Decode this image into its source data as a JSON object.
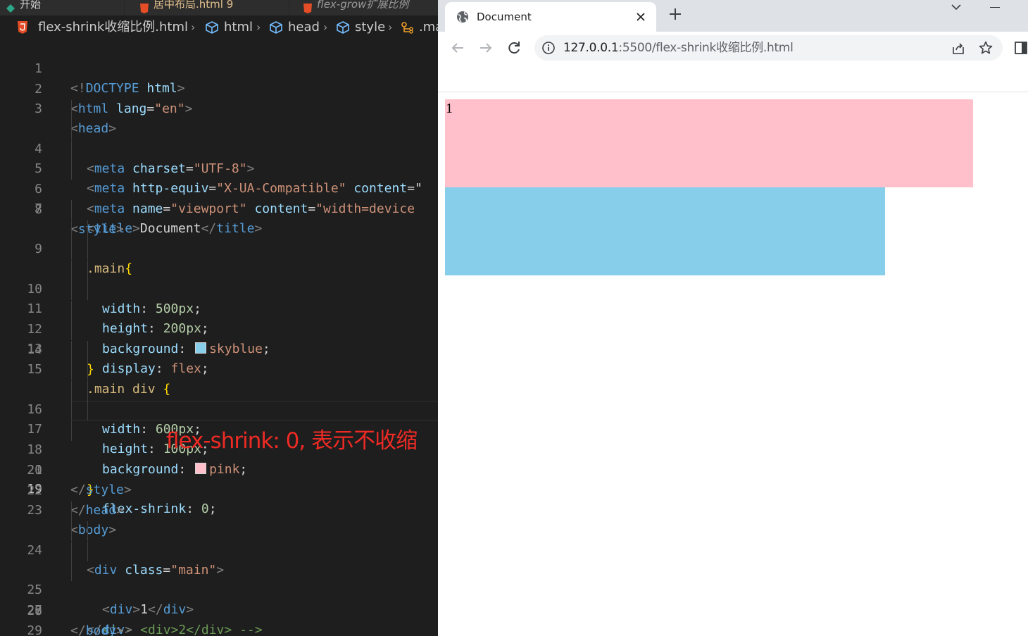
{
  "editor": {
    "tabs": [
      {
        "label": "开始"
      },
      {
        "label": "居中布局.html 9"
      },
      {
        "label": "flex-grow扩展比例"
      }
    ],
    "breadcrumb": {
      "file": "flex-shrink收缩比例.html",
      "items": [
        "html",
        "head",
        "style",
        ".ma"
      ]
    },
    "line_numbers": [
      "1",
      "2",
      "3",
      "4",
      "5",
      "6",
      "7",
      "8",
      "9",
      "10",
      "11",
      "12",
      "13",
      "14",
      "15",
      "16",
      "17",
      "18",
      "19",
      "20",
      "21",
      "22",
      "23",
      "24",
      "25",
      "26",
      "27",
      "28",
      "29"
    ],
    "active_line": "19",
    "code": {
      "l1": {
        "a": "<!",
        "b": "DOCTYPE",
        "c": " html",
        "d": ">"
      },
      "l2": {
        "a": "<",
        "b": "html",
        "c": " lang",
        "d": "=",
        "e": "\"en\"",
        "f": ">"
      },
      "l3": {
        "a": "<",
        "b": "head",
        "c": ">"
      },
      "l4": {
        "a": "<",
        "b": "meta",
        "c": " charset",
        "d": "=",
        "e": "\"UTF-8\"",
        "f": ">"
      },
      "l5": {
        "a": "<",
        "b": "meta",
        "c": " http-equiv",
        "d": "=",
        "e": "\"X-UA-Compatible\"",
        "f": " content",
        "g": "=\""
      },
      "l6": {
        "a": "<",
        "b": "meta",
        "c": " name",
        "d": "=",
        "e": "\"viewport\"",
        "f": " content",
        "g": "=",
        "h": "\"width=device"
      },
      "l7": {
        "a": "<",
        "b": "title",
        "c": ">",
        "d": "Document",
        "e": "</",
        "f": "title",
        "g": ">"
      },
      "l8": {
        "a": "<",
        "b": "style",
        "c": ">"
      },
      "l9": {
        "a": ".main",
        "b": "{"
      },
      "l10": {
        "a": "width",
        "b": ": ",
        "c": "500px",
        "d": ";"
      },
      "l11": {
        "a": "height",
        "b": ": ",
        "c": "200px",
        "d": ";"
      },
      "l12": {
        "a": "background",
        "b": ": ",
        "c": "skyblue",
        "d": ";"
      },
      "l13": {
        "a": "display",
        "b": ": ",
        "c": "flex",
        "d": ";"
      },
      "l14": {
        "a": "}"
      },
      "l15": {
        "a": ".main div",
        "b": " {"
      },
      "l16": {
        "a": "width",
        "b": ": ",
        "c": "600px",
        "d": ";"
      },
      "l17": {
        "a": "height",
        "b": ": ",
        "c": "100px",
        "d": ";"
      },
      "l18": {
        "a": "background",
        "b": ": ",
        "c": "pink",
        "d": ";"
      },
      "l19": {
        "a": "flex-shrink",
        "b": ": ",
        "c": "0",
        "d": ";"
      },
      "l20": {
        "a": "}"
      },
      "l21": {
        "a": "</",
        "b": "style",
        "c": ">"
      },
      "l22": {
        "a": "</",
        "b": "head",
        "c": ">"
      },
      "l23": {
        "a": "<",
        "b": "body",
        "c": ">"
      },
      "l24": {
        "a": "<",
        "b": "div",
        "c": " class",
        "d": "=",
        "e": "\"main\"",
        "f": ">"
      },
      "l25": {
        "a": "<",
        "b": "div",
        "c": ">",
        "d": "1",
        "e": "</",
        "f": "div",
        "g": ">"
      },
      "l26": {
        "a": "<!-- <div>2</div> -->"
      },
      "l27": {
        "a": "</",
        "b": "div",
        "c": ">"
      },
      "l28": {
        "a": "</",
        "b": "body",
        "c": ">"
      },
      "l29": {
        "a": "</",
        "b": "html",
        "c": ">"
      }
    },
    "annotation": "flex-shrink: 0, 表示不收缩",
    "swatches": {
      "skyblue": "#87ceeb",
      "pink": "#ffc0cb"
    }
  },
  "browser": {
    "tab_title": "Document",
    "tab_icon": "globe-icon",
    "url_host": "127.0.0.1",
    "url_path": ":5500/flex-shrink收缩比例.html",
    "page": {
      "box1_text": "1",
      "box1_color": "#ffc0cb",
      "box2_color": "#87ceeb"
    }
  }
}
